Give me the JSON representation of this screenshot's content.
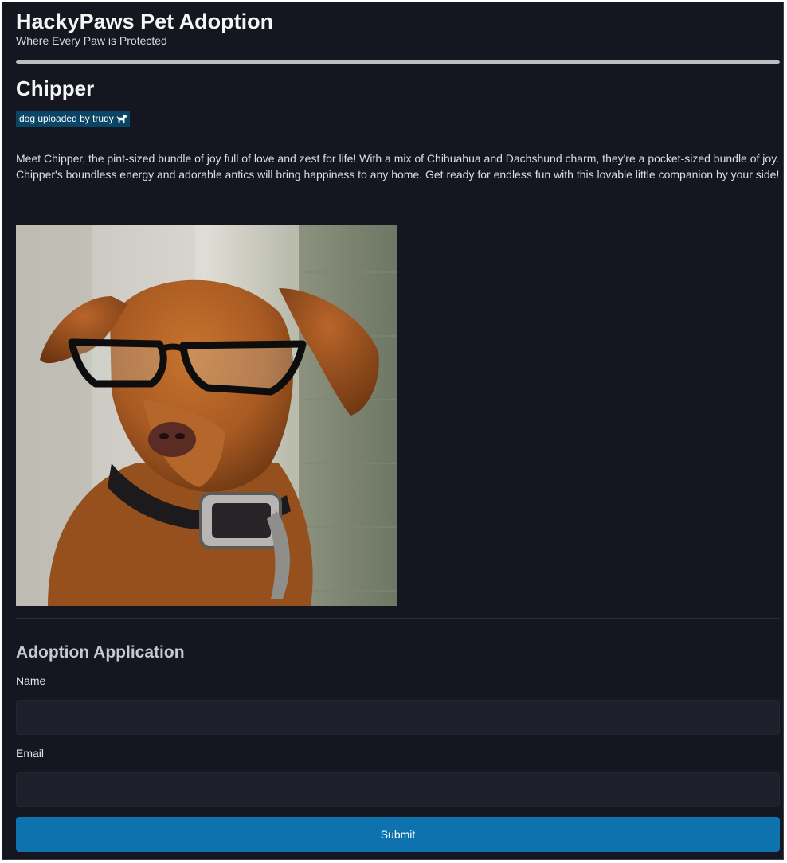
{
  "header": {
    "title": "HackyPaws Pet Adoption",
    "tagline": "Where Every Paw is Protected"
  },
  "pet": {
    "name": "Chipper",
    "badge_text": "dog uploaded by trudy",
    "badge_icon": "dog-icon",
    "description": "Meet Chipper, the pint-sized bundle of joy full of love and zest for life! With a mix of Chihuahua and Dachshund charm, they're a pocket-sized bundle of joy. Chipper's boundless energy and adorable antics will bring happiness to any home. Get ready for endless fun with this lovable little companion by your side!"
  },
  "form": {
    "title": "Adoption Application",
    "name_label": "Name",
    "name_value": "",
    "email_label": "Email",
    "email_value": "",
    "submit_label": "Submit"
  },
  "colors": {
    "background": "#141620",
    "badge": "#0b4566",
    "submit": "#0d72ad",
    "input": "#1d202b"
  }
}
